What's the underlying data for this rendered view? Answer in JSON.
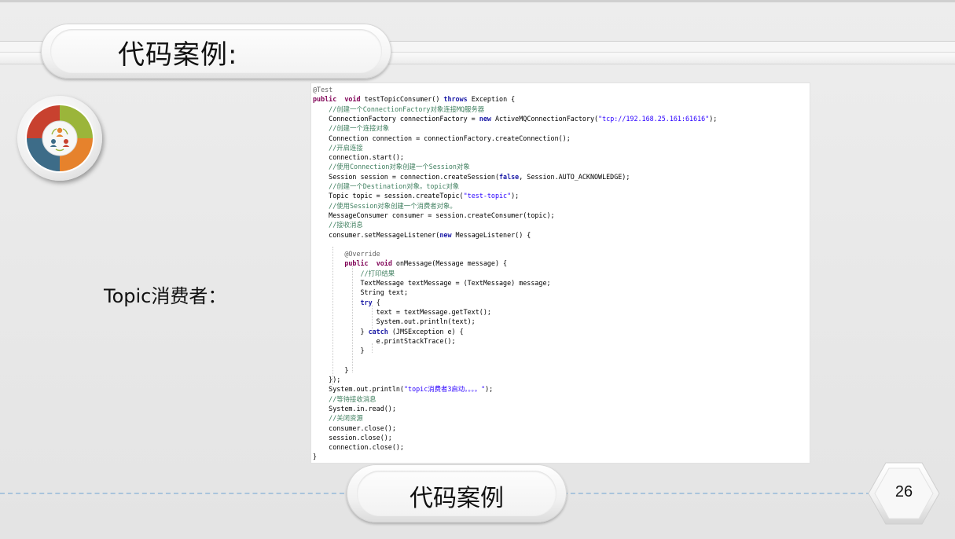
{
  "slide": {
    "title": "代码案例:",
    "section_label": "Topic消费者：",
    "footer_title": "代码案例",
    "page_number": "26"
  },
  "icons": {
    "logo": "cycle-arrows-people-icon"
  },
  "colors": {
    "logo_red": "#c8412f",
    "logo_green": "#9bb53a",
    "logo_orange": "#e6822c",
    "logo_blue": "#3d6c88",
    "footer_dash": "#a9c4dc",
    "keyword": "#7f0055",
    "comment": "#3f7f5f",
    "string": "#2a00ff"
  },
  "code": {
    "language": "java",
    "lines": [
      [
        [
          "ann",
          "@Test"
        ]
      ],
      [
        [
          "kw",
          "public"
        ],
        [
          "",
          "  "
        ],
        [
          "kw",
          "void"
        ],
        [
          "",
          " testTopicConsumer() "
        ],
        [
          "kwb",
          "throws"
        ],
        [
          "",
          " Exception {"
        ]
      ],
      [
        [
          "",
          "    "
        ],
        [
          "cm",
          "//创建一个ConnectionFactory对象连接MQ服务器"
        ]
      ],
      [
        [
          "",
          "    ConnectionFactory connectionFactory = "
        ],
        [
          "kwb",
          "new"
        ],
        [
          "",
          " ActiveMQConnectionFactory("
        ],
        [
          "str",
          "\"tcp://192.168.25.161:61616\""
        ],
        [
          "",
          ");"
        ]
      ],
      [
        [
          "",
          "    "
        ],
        [
          "cm",
          "//创建一个连接对象"
        ]
      ],
      [
        [
          "",
          "    Connection connection = connectionFactory.createConnection();"
        ]
      ],
      [
        [
          "",
          "    "
        ],
        [
          "cm",
          "//开启连接"
        ]
      ],
      [
        [
          "",
          "    connection.start();"
        ]
      ],
      [
        [
          "",
          "    "
        ],
        [
          "cm",
          "//使用Connection对象创建一个Session对象"
        ]
      ],
      [
        [
          "",
          "    Session session = connection.createSession("
        ],
        [
          "kwb",
          "false"
        ],
        [
          "",
          ", Session.AUTO_ACKNOWLEDGE);"
        ]
      ],
      [
        [
          "",
          "    "
        ],
        [
          "cm",
          "//创建一个Destination对象。topic对象"
        ]
      ],
      [
        [
          "",
          "    Topic topic = session.createTopic("
        ],
        [
          "str",
          "\"test-topic\""
        ],
        [
          "",
          ");"
        ]
      ],
      [
        [
          "",
          "    "
        ],
        [
          "cm",
          "//使用Session对象创建一个消费者对象。"
        ]
      ],
      [
        [
          "",
          "    MessageConsumer consumer = session.createConsumer(topic);"
        ]
      ],
      [
        [
          "",
          "    "
        ],
        [
          "cm",
          "//接收消息"
        ]
      ],
      [
        [
          "",
          "    consumer.setMessageListener("
        ],
        [
          "kwb",
          "new"
        ],
        [
          "",
          " MessageListener() {"
        ]
      ],
      [
        [
          "",
          ""
        ]
      ],
      [
        [
          "",
          "        "
        ],
        [
          "ann",
          "@Override"
        ]
      ],
      [
        [
          "",
          "        "
        ],
        [
          "kw",
          "public"
        ],
        [
          "",
          "  "
        ],
        [
          "kw",
          "void"
        ],
        [
          "",
          " onMessage(Message message) {"
        ]
      ],
      [
        [
          "",
          "            "
        ],
        [
          "cm",
          "//打印结果"
        ]
      ],
      [
        [
          "",
          "            TextMessage textMessage = (TextMessage) message;"
        ]
      ],
      [
        [
          "",
          "            String text;"
        ]
      ],
      [
        [
          "",
          "            "
        ],
        [
          "kwb",
          "try"
        ],
        [
          "",
          " {"
        ]
      ],
      [
        [
          "",
          "                text = textMessage.getText();"
        ]
      ],
      [
        [
          "",
          "                System.out.println(text);"
        ]
      ],
      [
        [
          "",
          "            } "
        ],
        [
          "kwb",
          "catch"
        ],
        [
          "",
          " (JMSException e) {"
        ]
      ],
      [
        [
          "",
          "                e.printStackTrace();"
        ]
      ],
      [
        [
          "",
          "            }"
        ]
      ],
      [
        [
          "",
          ""
        ]
      ],
      [
        [
          "",
          "        }"
        ]
      ],
      [
        [
          "",
          "    });"
        ]
      ],
      [
        [
          "",
          "    System.out.println("
        ],
        [
          "str",
          "\"topic消费者3启动。。。。\""
        ],
        [
          "",
          ");"
        ]
      ],
      [
        [
          "",
          "    "
        ],
        [
          "cm",
          "//等待接收消息"
        ]
      ],
      [
        [
          "",
          "    System.in.read();"
        ]
      ],
      [
        [
          "",
          "    "
        ],
        [
          "cm",
          "//关闭资源"
        ]
      ],
      [
        [
          "",
          "    consumer.close();"
        ]
      ],
      [
        [
          "",
          "    session.close();"
        ]
      ],
      [
        [
          "",
          "    connection.close();"
        ]
      ],
      [
        [
          "",
          "}"
        ]
      ]
    ]
  }
}
